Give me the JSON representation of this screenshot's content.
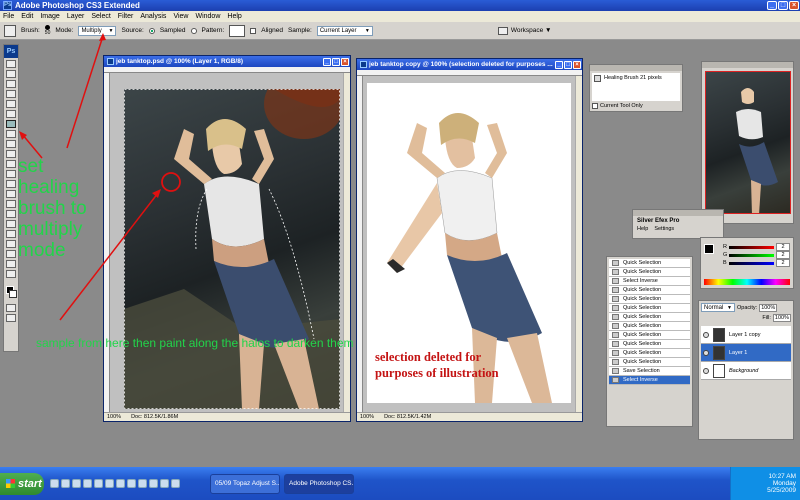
{
  "app": {
    "title": "Adobe Photoshop CS3 Extended",
    "badge": "Ps"
  },
  "menu": [
    "File",
    "Edit",
    "Image",
    "Layer",
    "Select",
    "Filter",
    "Analysis",
    "View",
    "Window",
    "Help"
  ],
  "options": {
    "brush_label": "Brush:",
    "brush_size": "50",
    "mode_label": "Mode:",
    "mode_value": "Multiply",
    "source_label": "Source:",
    "sampled_label": "Sampled",
    "pattern_label": "Pattern:",
    "aligned_label": "Aligned",
    "sample_label": "Sample:",
    "sample_value": "Current Layer",
    "workspace_label": "Workspace ▼"
  },
  "doc1": {
    "title": "jeb tanktop.psd @ 100% (Layer 1, RGB/8)",
    "zoom": "100%",
    "doc_size": "Doc: 812.5K/1.86M"
  },
  "doc2": {
    "title": "jeb tanktop copy @ 100% (selection deleted for  purposes ...",
    "zoom": "100%",
    "doc_size": "Doc: 812.5K/1.42M"
  },
  "brush_preset": {
    "label": "Healing Brush 21 pixels",
    "current_tool_only": "Current Tool Only"
  },
  "silver_efex": {
    "title": "Silver Efex Pro",
    "help": "Help",
    "settings": "Settings"
  },
  "color_panel": {
    "r_value": "2",
    "g_value": "2",
    "b_value": "2",
    "r_label": "R",
    "g_label": "G",
    "b_label": "B"
  },
  "history": {
    "items": [
      "Quick Selection",
      "Quick Selection",
      "Select Inverse",
      "Quick Selection",
      "Quick Selection",
      "Quick Selection",
      "Quick Selection",
      "Quick Selection",
      "Quick Selection",
      "Quick Selection",
      "Quick Selection",
      "Quick Selection",
      "Save Selection",
      "Select Inverse"
    ]
  },
  "layers": {
    "blend_mode": "Normal",
    "opacity_label": "Opacity:",
    "opacity_value": "100%",
    "fill_label": "Fill:",
    "fill_value": "100%",
    "items": [
      "Layer 1 copy",
      "Layer 1",
      "Background"
    ]
  },
  "annotations": {
    "set_healing": [
      "set",
      "healing",
      "brush to",
      "multiply",
      "mode"
    ],
    "sample_note": "sample from here then paint along the halos to darken them",
    "selection_note": [
      "selection deleted for",
      "purposes of illustration"
    ]
  },
  "taskbar": {
    "start": "start",
    "tasks": [
      "05/09 Topaz Adjust S...",
      "Adobe Photoshop CS..."
    ],
    "time": "10:27 AM",
    "day": "Monday",
    "date": "5/25/2009"
  },
  "colors": {
    "annotation_green": "#22d44a",
    "annotation_red": "#c41414",
    "arrow_red": "#e01010"
  }
}
